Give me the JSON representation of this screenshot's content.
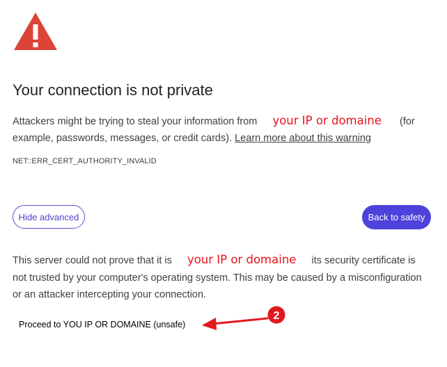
{
  "page": {
    "title": "Your connection is not private",
    "intro": {
      "before": "Attackers might be trying to steal your information from",
      "domain_placeholder": "your IP or domaine",
      "after": "(for example, passwords, messages, or credit cards).",
      "learn_more_link": "Learn more about this warning"
    },
    "error_code": "NET::ERR_CERT_AUTHORITY_INVALID",
    "buttons": {
      "hide_advanced": "Hide advanced",
      "back_to_safety": "Back to safety"
    },
    "advanced": {
      "before": "This server could not prove that it is",
      "domain_placeholder": "your IP or domaine",
      "after": "its security certificate is not trusted by your computer's operating system. This may be caused by a misconfiguration or an attacker intercepting your connection."
    },
    "proceed_link": "Proceed to YOU IP OR DOMAINE (unsafe)",
    "annotation": {
      "badge_number": "2",
      "color": "#e0191f"
    }
  },
  "colors": {
    "warning_red": "#db4437",
    "accent": "#4d42db",
    "annotation_red": "#e8121a"
  },
  "icons": [
    "warning-triangle-icon",
    "annotation-arrow-icon"
  ]
}
